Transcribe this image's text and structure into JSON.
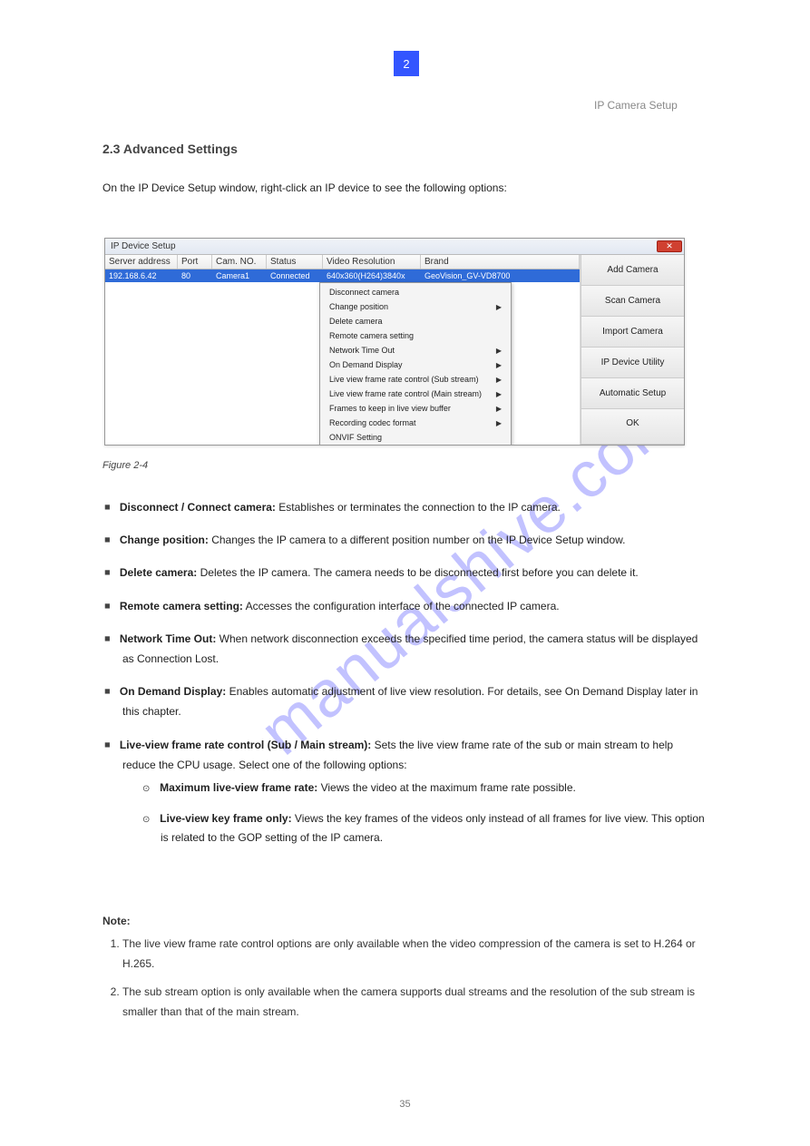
{
  "chapter": {
    "num": "2",
    "label": "IP Camera Setup",
    "heading": "2.3  Advanced Settings"
  },
  "intro_line": "On the IP Device Setup window, right-click an IP device to see the following options:",
  "dialog": {
    "title": "IP Device Setup",
    "close_glyph": "✕",
    "cols": [
      "Server address",
      "Port",
      "Cam. NO.",
      "Status",
      "Video Resolution",
      "Brand"
    ],
    "row": {
      "addr": "192.168.6.42",
      "port": "80",
      "cam": "Camera1",
      "status": "Connected",
      "vres": "640x360(H264)3840x",
      "brand": "GeoVision_GV-VD8700"
    },
    "buttons": [
      "Add Camera",
      "Scan Camera",
      "Import Camera",
      "IP Device Utility",
      "Automatic Setup",
      "OK"
    ],
    "menu": [
      {
        "label": "Disconnect camera",
        "sub": false
      },
      {
        "label": "Change position",
        "sub": true
      },
      {
        "label": "Delete camera",
        "sub": false
      },
      {
        "label": "Remote camera setting",
        "sub": false
      },
      {
        "label": "Network Time Out",
        "sub": true
      },
      {
        "label": "On Demand Display",
        "sub": true
      },
      {
        "label": "Live view frame rate control (Sub stream)",
        "sub": true
      },
      {
        "label": "Live view frame rate control (Main stream)",
        "sub": true
      },
      {
        "label": "Frames to keep in live view buffer",
        "sub": true
      },
      {
        "label": "Recording codec format",
        "sub": true
      },
      {
        "label": "ONVIF Setting",
        "sub": false
      }
    ]
  },
  "figcap": "Figure 2-4",
  "bullets": [
    {
      "head": "Disconnect / Connect camera:",
      "body": " Establishes or terminates the connection to the IP camera."
    },
    {
      "head": "Change position:",
      "body": " Changes the IP camera to a different position number on the IP Device Setup window."
    },
    {
      "head": "Delete camera:",
      "body": " Deletes the IP camera. The camera needs to be disconnected first before you can delete it."
    },
    {
      "head": "Remote camera setting:",
      "body": " Accesses the configuration interface of the connected IP camera."
    },
    {
      "head": "Network Time Out:",
      "body": " When network disconnection exceeds the specified time period, the camera status will be displayed as Connection Lost."
    },
    {
      "head": "On Demand Display:",
      "body": " Enables automatic adjustment of live view resolution. For details, see On Demand Display later in this chapter."
    },
    {
      "head": "Live-view frame rate control (Sub / Main stream):",
      "body": " Sets the live view frame rate of the sub or main stream to help reduce the CPU usage. Select one of the following options:",
      "sub": [
        {
          "head": "Maximum live-view frame rate:",
          "body": " Views the video at the maximum frame rate possible."
        },
        {
          "head": "Live-view key frame only:",
          "body": " Views the key frames of the videos only instead of all frames for live view. This option is related to the GOP setting of the IP camera."
        }
      ]
    }
  ],
  "notes_head": "Note:",
  "notes": [
    "The live view frame rate control options are only available when the video compression of the camera is set to H.264 or H.265.",
    "The sub stream option is only available when the camera supports dual streams and the resolution of the sub stream is smaller than that of the main stream."
  ],
  "page_num": "35"
}
